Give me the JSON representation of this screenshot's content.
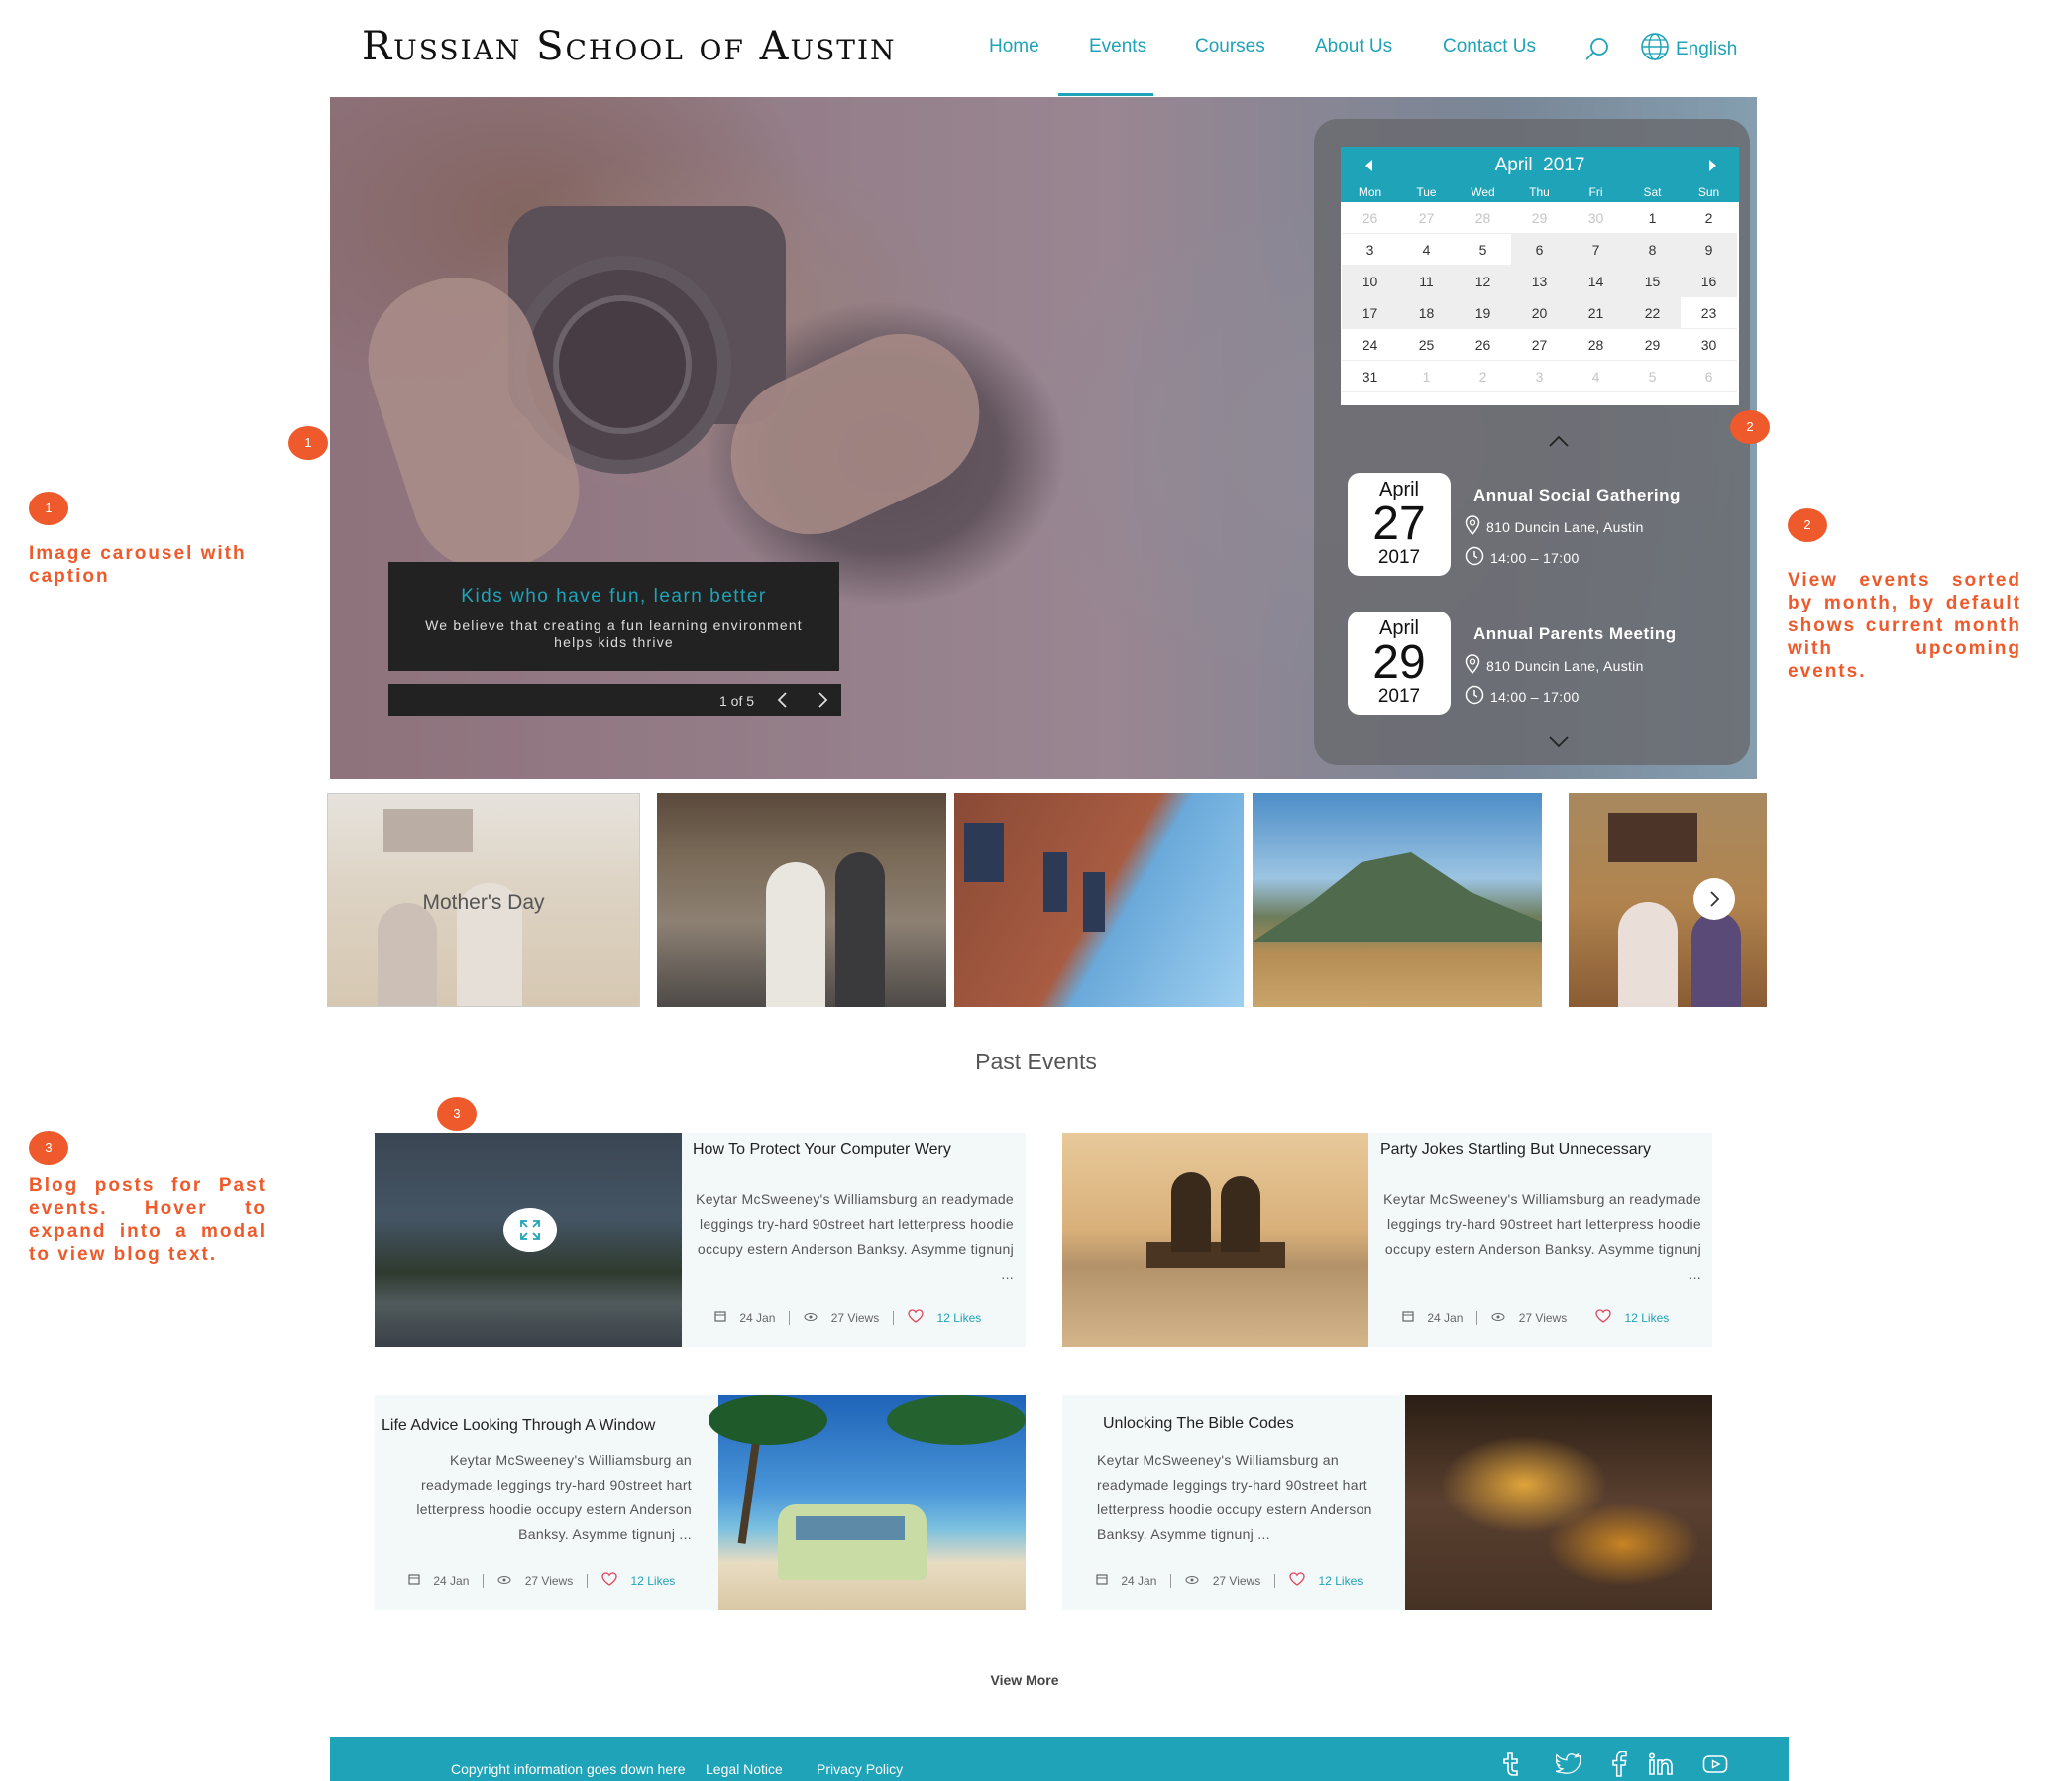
{
  "header": {
    "logo": "Russian School of Austin",
    "nav": [
      "Home",
      "Events",
      "Courses",
      "About Us",
      "Contact Us"
    ],
    "active_nav": "Events",
    "language": "English"
  },
  "carousel": {
    "caption_title": "Kids who have fun, learn better",
    "caption_text": "We believe that creating a fun learning environment helps kids thrive",
    "counter": "1 of 5"
  },
  "calendar": {
    "month": "April",
    "year": "2017",
    "day_names": [
      "Mon",
      "Tue",
      "Wed",
      "Thu",
      "Fri",
      "Sat",
      "Sun"
    ],
    "weeks": [
      [
        "26",
        "27",
        "28",
        "29",
        "30",
        "1",
        "2"
      ],
      [
        "3",
        "4",
        "5",
        "6",
        "7",
        "8",
        "9"
      ],
      [
        "10",
        "11",
        "12",
        "13",
        "14",
        "15",
        "16"
      ],
      [
        "17",
        "18",
        "19",
        "20",
        "21",
        "22",
        "23"
      ],
      [
        "24",
        "25",
        "26",
        "27",
        "28",
        "29",
        "30"
      ],
      [
        "31",
        "1",
        "2",
        "3",
        "4",
        "5",
        "6"
      ]
    ]
  },
  "events": [
    {
      "month": "April",
      "day": "27",
      "year": "2017",
      "title": "Annual Social Gathering",
      "location": "810 Duncin Lane, Austin",
      "time": "14:00 – 17:00"
    },
    {
      "month": "April",
      "day": "29",
      "year": "2017",
      "title": "Annual Parents Meeting",
      "location": "810 Duncin Lane, Austin",
      "time": "14:00 – 17:00"
    }
  ],
  "thumbnails": {
    "first_label": "Mother's Day"
  },
  "annotations": [
    {
      "num": "1",
      "text": "Image carousel with caption"
    },
    {
      "num": "2",
      "text": "View events sorted by month, by default shows current month with upcoming events."
    },
    {
      "num": "3",
      "text": "Blog posts for Past events. Hover to expand into a modal to view blog text."
    }
  ],
  "past_events": {
    "title": "Past Events",
    "posts": [
      {
        "title": "How To Protect Your Computer Wery",
        "excerpt": "Keytar McSweeney's Williamsburg an readymade leggings try-hard 90street hart letterpress hoodie occupy estern Anderson Banksy. Asymme tignunj ...",
        "date": "24 Jan",
        "views": "27 Views",
        "likes": "12 Likes"
      },
      {
        "title": "Party Jokes Startling But Unnecessary",
        "excerpt": "Keytar McSweeney's Williamsburg an readymade leggings try-hard 90street hart letterpress hoodie occupy estern Anderson Banksy. Asymme tignunj ...",
        "date": "24 Jan",
        "views": "27 Views",
        "likes": "12 Likes"
      },
      {
        "title": "Life Advice Looking Through A Window",
        "excerpt": "Keytar McSweeney's Williamsburg an readymade leggings try-hard 90street hart letterpress hoodie occupy estern Anderson Banksy. Asymme tignunj ...",
        "date": "24 Jan",
        "views": "27 Views",
        "likes": "12 Likes"
      },
      {
        "title": "Unlocking The Bible Codes",
        "excerpt": "Keytar McSweeney's Williamsburg an readymade leggings try-hard 90street hart letterpress hoodie occupy estern Anderson Banksy. Asymme tignunj ...",
        "date": "24 Jan",
        "views": "27 Views",
        "likes": "12 Likes"
      }
    ],
    "view_more": "View More"
  },
  "footer": {
    "copyright": "Copyright information goes down here",
    "legal": "Legal Notice",
    "privacy": "Privacy Policy",
    "social_icons": [
      "tumblr-icon",
      "twitter-icon",
      "facebook-icon",
      "linkedin-icon",
      "youtube-icon"
    ]
  },
  "colors": {
    "accent": "#1fa3b8",
    "annotation": "#ee5a2b"
  }
}
